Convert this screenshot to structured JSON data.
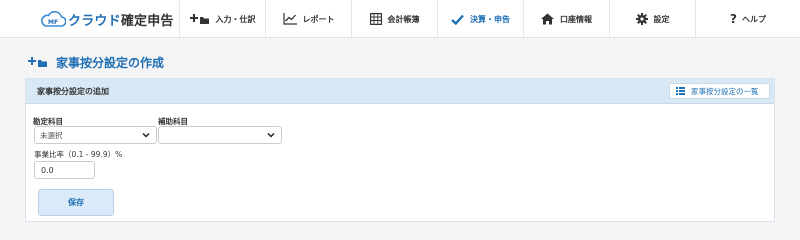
{
  "app": {
    "logo_mark": "MF",
    "logo_name_blue": "クラウド",
    "logo_name_dark": "確定申告"
  },
  "nav": {
    "items": [
      {
        "label": "入力・仕訳",
        "icon": "plus-folder-icon"
      },
      {
        "label": "レポート",
        "icon": "line-chart-icon"
      },
      {
        "label": "会計帳簿",
        "icon": "ledger-grid-icon"
      },
      {
        "label": "決算・申告",
        "icon": "checkmark-icon",
        "active": true
      },
      {
        "label": "口座情報",
        "icon": "home-icon"
      },
      {
        "label": "設定",
        "icon": "gear-icon"
      },
      {
        "label": "ヘルプ",
        "icon": "question-icon"
      }
    ]
  },
  "page": {
    "title": "家事按分設定の作成",
    "title_icon": "plus-folder-icon"
  },
  "panel": {
    "title": "家事按分設定の追加",
    "list_link": "家事按分設定の一覧",
    "list_icon": "list-icon"
  },
  "form": {
    "account_label": "勘定科目",
    "account_value": "未選択",
    "sub_account_label": "補助科目",
    "sub_account_value": "",
    "ratio_label": "事業比率（0.1 - 99.9）%",
    "ratio_value": "0.0",
    "save_label": "保存"
  },
  "colors": {
    "brand_blue": "#1f6fb5",
    "panel_header": "#d9e8f5",
    "save_button_bg": "#dbeaf8"
  }
}
